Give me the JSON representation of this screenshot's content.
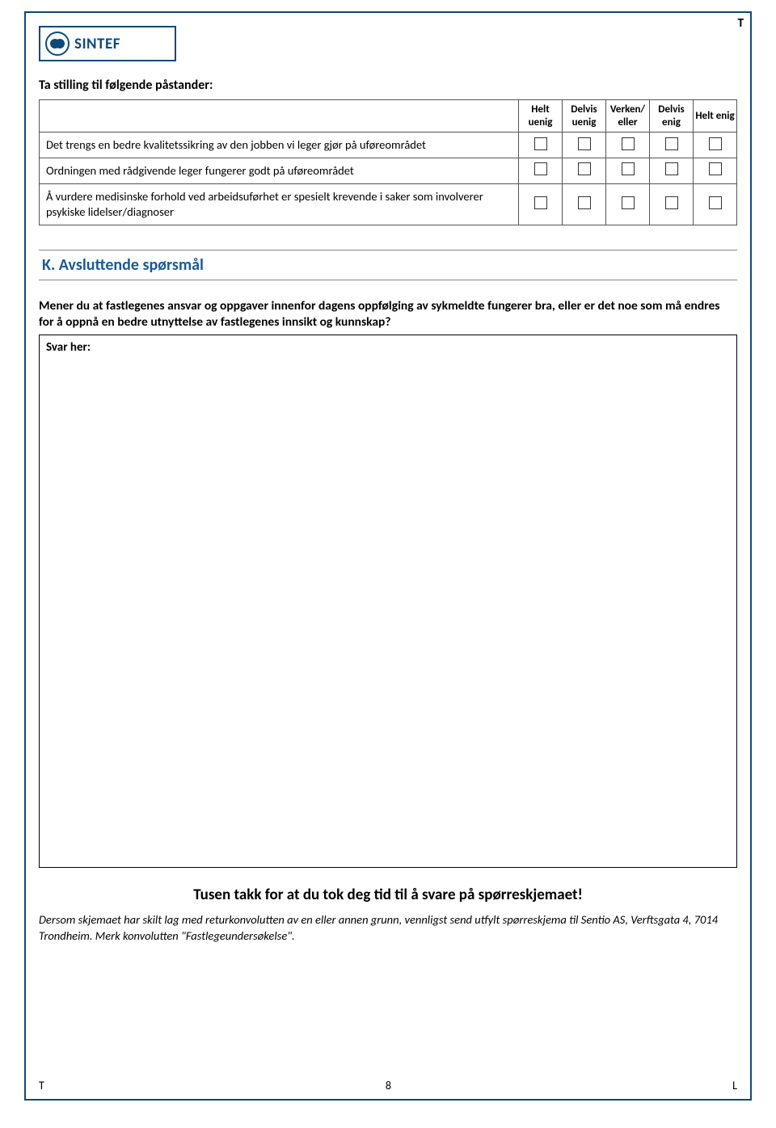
{
  "corner": "T",
  "logo_text": "SINTEF",
  "instruction": "Ta stilling til følgende påstander:",
  "matrix": {
    "headers": [
      "Helt uenig",
      "Delvis uenig",
      "Verken/ eller",
      "Delvis enig",
      "Helt enig"
    ],
    "rows": [
      "Det trengs en bedre kvalitetssikring av den jobben vi leger gjør på uføreområdet",
      "Ordningen med rådgivende leger fungerer godt på uføreområdet",
      "Å vurdere medisinske forhold ved arbeidsuførhet er spesielt krevende i saker som involverer psykiske lidelser/diagnoser"
    ]
  },
  "section_k": {
    "title": "K. Avsluttende spørsmål",
    "question": "Mener du at fastlegenes ansvar og oppgaver innenfor dagens oppfølging av sykmeldte fungerer bra, eller er det noe som må endres for å oppnå en bedre utnyttelse av fastlegenes innsikt og kunnskap?",
    "answer_label": "Svar her:"
  },
  "thanks": "Tusen takk for at du tok deg tid til å svare på spørreskjemaet!",
  "closing": "Dersom skjemaet har skilt lag med returkonvolutten av en eller annen grunn, vennligst send utfylt spørreskjema til Sentio AS, Verftsgata 4, 7014 Trondheim. Merk konvolutten \"Fastlegeundersøkelse\".",
  "footer": {
    "left": "T",
    "center": "8",
    "right": "L"
  }
}
